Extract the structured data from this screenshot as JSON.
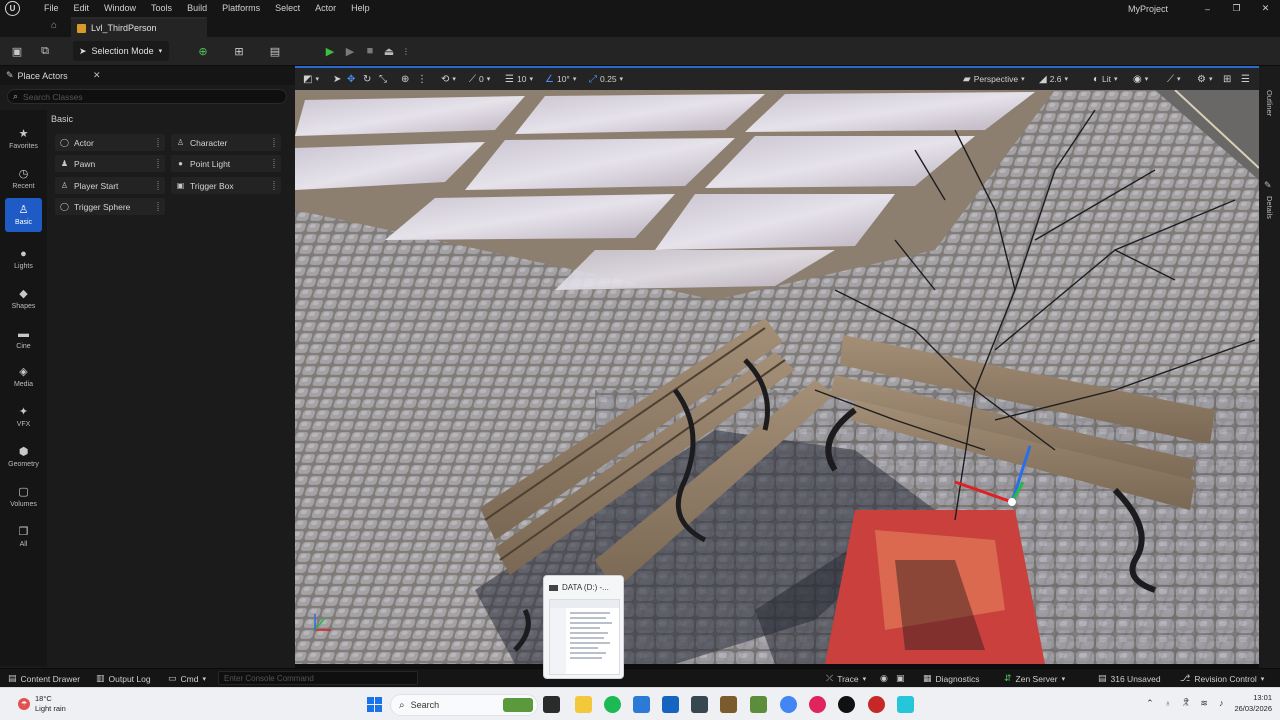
{
  "app": {
    "logo": "unreal-logo",
    "project_name": "MyProject",
    "window_controls": [
      "–",
      "❐",
      "✕"
    ]
  },
  "menu": [
    "File",
    "Edit",
    "Window",
    "Tools",
    "Build",
    "Platforms",
    "Select",
    "Actor",
    "Help"
  ],
  "tabs": {
    "level_tab": "Lvl_ThirdPerson"
  },
  "toolbar": {
    "selection_mode": "Selection Mode"
  },
  "place_actors": {
    "title": "Place Actors",
    "search_placeholder": "Search Classes",
    "categories": [
      {
        "label": "Favorites",
        "icon": "star-icon"
      },
      {
        "label": "Recent",
        "icon": "clock-icon"
      },
      {
        "label": "Basic",
        "icon": "basic-icon"
      },
      {
        "label": "Lights",
        "icon": "light-icon"
      },
      {
        "label": "Shapes",
        "icon": "shapes-icon"
      },
      {
        "label": "Cine",
        "icon": "cine-icon"
      },
      {
        "label": "Media",
        "icon": "media-icon"
      },
      {
        "label": "VFX",
        "icon": "vfx-icon"
      },
      {
        "label": "Geometry",
        "icon": "geometry-icon"
      },
      {
        "label": "Volumes",
        "icon": "volumes-icon"
      },
      {
        "label": "All",
        "icon": "all-icon"
      }
    ],
    "section": "Basic",
    "actors": [
      "Actor",
      "Character",
      "Pawn",
      "Point Light",
      "Player Start",
      "Trigger Box",
      "Trigger Sphere"
    ]
  },
  "viewport": {
    "perspective": "Perspective",
    "fov": "2.6",
    "view_mode": "Lit",
    "grid_translate": "10",
    "grid_rotate": "10°",
    "grid_scale": "0.25",
    "snap_value": "0"
  },
  "side_tabs": [
    "Outliner",
    "Details"
  ],
  "statusbar": {
    "content_drawer": "Content Drawer",
    "output_log": "Output Log",
    "cmd": "Cmd",
    "console_placeholder": "Enter Console Command",
    "trace": "Trace",
    "diagnostics": "Diagnostics",
    "zen_server": "Zen Server",
    "unsaved": "316 Unsaved",
    "revision_control": "Revision Control"
  },
  "taskbar": {
    "temperature": "18°C",
    "weather": "Light rain",
    "search": "Search",
    "time": "13:01",
    "date": "26/03/2026",
    "explorer_popup_title": "DATA (D:) -..."
  },
  "colors": {
    "accent": "#1f5bc4",
    "play": "#3fbf3f",
    "toolbar_bg": "#242424"
  }
}
